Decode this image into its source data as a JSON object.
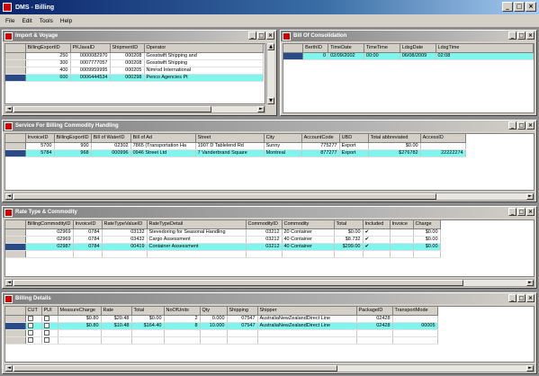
{
  "window": {
    "title": "DMS - Billing",
    "btn_min": "_",
    "btn_max": "□",
    "btn_close": "×"
  },
  "menu": [
    "File",
    "Edit",
    "Tools",
    "Help"
  ],
  "panel_btns": {
    "min": "_",
    "max": "□",
    "close": "×"
  },
  "shipments_panel": {
    "title": "Import & Voyage",
    "columns": [
      "",
      "BillingExportID",
      "PKJavaID",
      "ShipmentID",
      "Operator"
    ],
    "rows": [
      [
        "",
        "250",
        "0000082970",
        "000208",
        "Gosstwift Shipping and"
      ],
      [
        "",
        "300",
        "0007777057",
        "000208",
        "Gosstwift Shipping"
      ],
      [
        "",
        "400",
        "0009959995",
        "000205",
        "Nimrod International"
      ],
      [
        "",
        "600",
        "0006444534",
        "000298",
        "Penco Agencies Pt"
      ]
    ],
    "highlight_row": 3
  },
  "consolidation_panel": {
    "title": "Bill Of Consolidation",
    "columns": [
      "",
      "BerthID",
      "TimeDate",
      "TimeTime",
      "LdsgDate",
      "LdsgTime"
    ],
    "rows": [
      [
        "",
        "0",
        "02/09/2002",
        "00:00",
        "06/08/2009",
        "02:08"
      ]
    ],
    "highlight_row": 0
  },
  "handling_panel": {
    "title": "Service For Billing Commodity Handling",
    "columns": [
      "",
      "InvoiceID",
      "BillingExportID",
      "Bill of WaterID",
      "Bill of Ad",
      "Street",
      "City",
      "AccountCode",
      "UBD",
      "Total abbreviated",
      "AccessID"
    ],
    "rows": [
      [
        "",
        "5700",
        "900",
        "02302",
        "7865 (Transportation Ha",
        "1907 D Tablelend Rd",
        "Sunny",
        "775277",
        "Export",
        "$0.00",
        ""
      ],
      [
        "",
        "5784",
        "968",
        "000996",
        "0946 Street Ltd",
        "7 Vanderbrand Square",
        "Montreal",
        "877277",
        "Export",
        "$276782",
        "22222274"
      ]
    ],
    "highlight_row": 1
  },
  "rates_panel": {
    "title": "Rate Type & Commodity",
    "columns": [
      "",
      "BillingCommodityID",
      "InvoiceID",
      "RateTypeValueID",
      "RateTypeDetail",
      "CommodityID",
      "Commodity",
      "Total",
      "Included",
      "Invoice",
      "Charge"
    ],
    "rows": [
      [
        "",
        "02969",
        "0784",
        "03132",
        "Stevedoring for Seasonal Handling",
        "03212",
        "20 Container",
        "$0.00",
        "✔",
        "",
        "$0.00"
      ],
      [
        "",
        "02969",
        "0784",
        "03432",
        "Cargo Assessment",
        "03212",
        "40 Container",
        "$8.732",
        "✔",
        "",
        "$0.00"
      ],
      [
        "",
        "02987",
        "0784",
        "00419",
        "Container Assessment",
        "03212",
        "40 Container",
        "$299.00",
        "✔",
        "",
        "$0.00"
      ],
      [
        "",
        "",
        "",
        "",
        "",
        "",
        "",
        "",
        "",
        "",
        ""
      ]
    ],
    "highlight_row": 2
  },
  "details_panel": {
    "title": "Billing Details",
    "columns": [
      "",
      "CUT",
      "PUI",
      "MeasureCharge",
      "Rate",
      "Total",
      "NoOfUnits",
      "Qty",
      "Shipping",
      "Shipper",
      "PackageID",
      "TransportMode"
    ],
    "rows": [
      [
        "",
        "",
        "",
        "$0.80",
        "$20.48",
        "$0.00",
        "2",
        "0.000",
        "07547",
        "AustraliaNewZealandDirect Line",
        "02428",
        ""
      ],
      [
        "",
        "",
        "",
        "$0.80",
        "$10.48",
        "$164.40",
        "8",
        "10.000",
        "07547",
        "AustraliaNewZealandDirect Line",
        "02428",
        "00005"
      ],
      [
        "",
        "",
        "",
        "",
        "",
        "",
        "",
        "",
        "",
        "",
        "",
        ""
      ],
      [
        "",
        "",
        "",
        "",
        "",
        "",
        "",
        "",
        "",
        "",
        "",
        ""
      ]
    ],
    "highlight_row": 1
  },
  "scroll_arrows": {
    "left": "◄",
    "right": "►",
    "up": "▲",
    "down": "▼"
  },
  "colors": {
    "title_dark": "#0a246a",
    "highlight_row": "#7ff5ee",
    "chrome": "#d4d0c8"
  }
}
